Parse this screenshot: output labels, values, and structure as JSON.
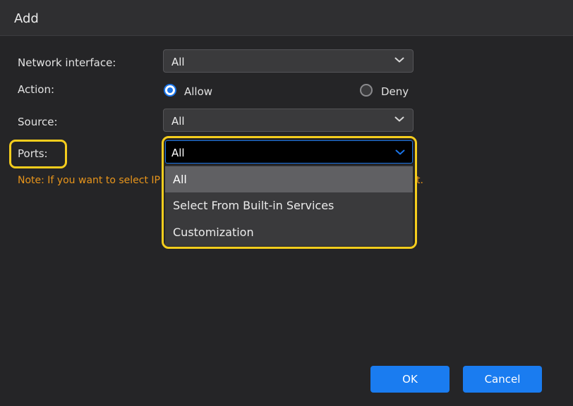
{
  "dialog": {
    "title": "Add"
  },
  "form": {
    "network_interface": {
      "label": "Network interface:",
      "value": "All"
    },
    "action": {
      "label": "Action:",
      "options": [
        {
          "label": "Allow",
          "checked": true
        },
        {
          "label": "Deny",
          "checked": false
        }
      ]
    },
    "source": {
      "label": "Source:",
      "value": "All"
    },
    "ports": {
      "label": "Ports:",
      "value": "All",
      "dropdown_options": [
        "All",
        "Select From Built-in Services",
        "Customization"
      ],
      "highlighted_option": "All"
    },
    "note": {
      "visible_start": "Note: If you want to select IP",
      "visible_end": "t."
    }
  },
  "buttons": {
    "ok": "OK",
    "cancel": "Cancel"
  },
  "colors": {
    "accent": "#1a7cf0",
    "highlight": "#f5cd1d",
    "note": "#e8951b",
    "background": "#252527"
  },
  "icons": {
    "dropdown": "chevron-down-icon",
    "radio_on": "radio-selected-icon",
    "radio_off": "radio-unselected-icon"
  }
}
